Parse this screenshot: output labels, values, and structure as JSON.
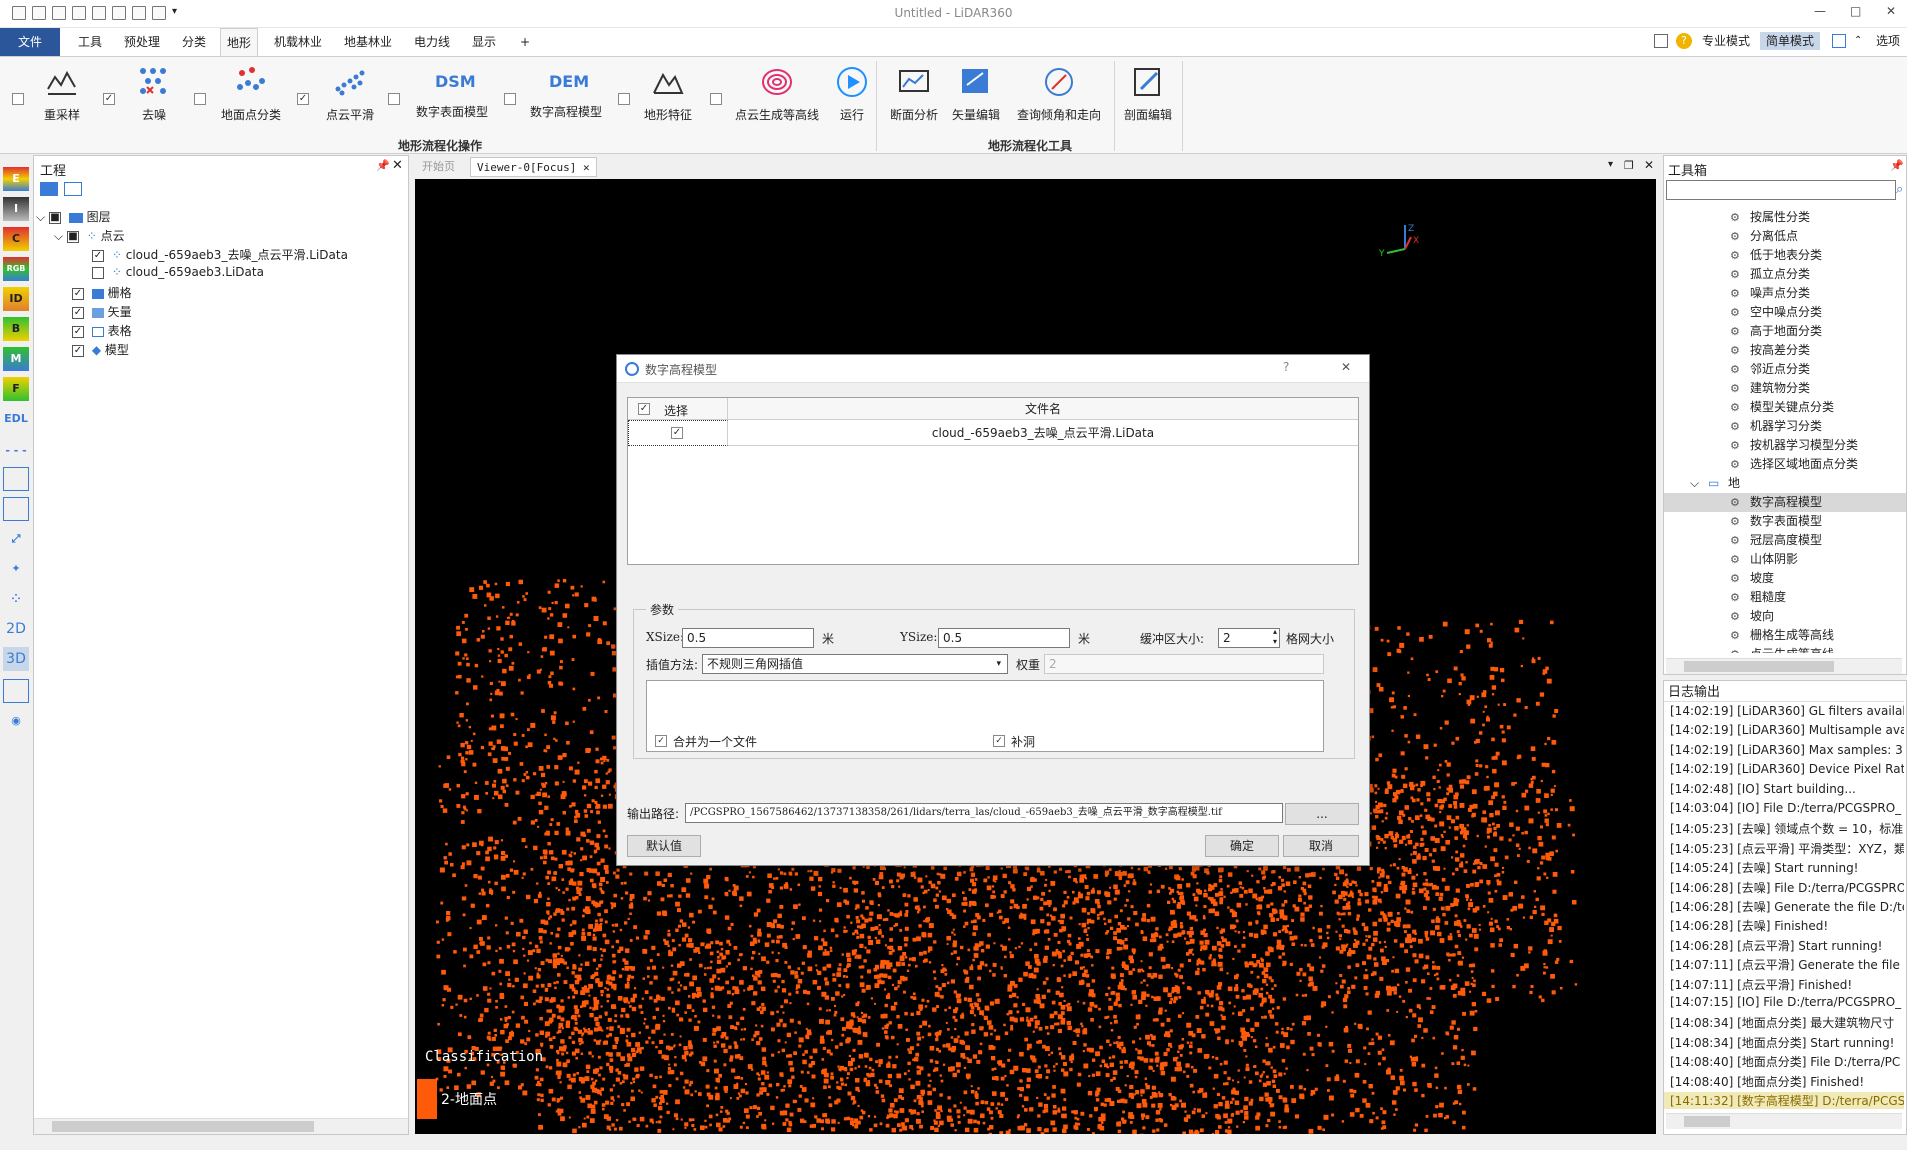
{
  "window": {
    "title": "Untitled - LiDAR360",
    "min": "—",
    "max": "□",
    "close": "✕"
  },
  "menu": {
    "tabs": [
      "文件",
      "工具",
      "预处理",
      "分类",
      "地形",
      "机载林业",
      "地基林业",
      "电力线",
      "显示",
      "+"
    ],
    "active_tab": "地形",
    "right": {
      "pro_mode": "专业模式",
      "simple_mode": "简单模式",
      "options": "选项"
    }
  },
  "ribbon": {
    "buttons": [
      "重采样",
      "去噪",
      "地面点分类",
      "点云平滑",
      "数字表面模型",
      "数字高程模型",
      "地形特征",
      "点云生成等高线",
      "运行",
      "断面分析",
      "矢量编辑",
      "查询倾角和走向",
      "剖面编辑"
    ],
    "dsm_text": "DSM",
    "dem_text": "DEM",
    "groups": [
      "地形流程化操作",
      "地形流程化工具"
    ]
  },
  "left_toolbar": [
    "E",
    "I",
    "C",
    "RGB",
    "ID",
    "B",
    "M",
    "F",
    "EDL",
    "2D",
    "3D"
  ],
  "project": {
    "title": "工程",
    "tree": {
      "layers": "图层",
      "pointcloud": "点云",
      "files": [
        "cloud_-659aeb3_去噪_点云平滑.LiData",
        "cloud_-659aeb3.LiData"
      ],
      "raster": "栅格",
      "vector": "矢量",
      "table": "表格",
      "model": "模型"
    }
  },
  "viewer": {
    "tabs": [
      "开始页",
      "Viewer-0[Focus]"
    ],
    "legend_title": "Classification",
    "legend_item": "2-地面点",
    "legend_color": "#ff5a0a",
    "axis_labels": {
      "x": "X",
      "y": "Y",
      "z": "Z"
    }
  },
  "toolbox": {
    "title": "工具箱",
    "search_placeholder": "",
    "items": [
      "按属性分类",
      "分离低点",
      "低于地表分类",
      "孤立点分类",
      "噪声点分类",
      "空中噪点分类",
      "高于地面分类",
      "按高差分类",
      "邻近点分类",
      "建筑物分类",
      "模型关键点分类",
      "机器学习分类",
      "按机器学习模型分类",
      "选择区域地面点分类"
    ],
    "category": "地形",
    "terrain_items": [
      "数字高程模型",
      "数字表面模型",
      "冠层高度模型",
      "山体阴影",
      "坡度",
      "粗糙度",
      "坡向",
      "栅格生成等高线",
      "点云生成等高线"
    ],
    "selected": "数字高程模型"
  },
  "log": {
    "title": "日志输出",
    "lines": [
      "[14:02:19] [LiDAR360]   GL filters availab",
      "[14:02:19] [LiDAR360]   Multisample ava",
      "[14:02:19] [LiDAR360]   Max samples: 3",
      "[14:02:19] [LiDAR360]   Device Pixel Rati",
      "[14:02:48] [IO]    Start building...",
      "[14:03:04] [IO]    File D:/terra/PCGSPRO_",
      "[14:05:23] [去噪]    领域点个数 = 10，标准",
      "[14:05:23] [点云平滑]   平滑类型：XYZ，類",
      "[14:05:24] [去噪]    Start running!",
      "[14:06:28] [去噪]    File D:/terra/PCGSPRO",
      "[14:06:28] [去噪]    Generate the file D:/te",
      "[14:06:28] [去噪]    Finished!",
      "[14:06:28] [点云平滑]   Start running!",
      "[14:07:11] [点云平滑]   Generate the file",
      "[14:07:11] [点云平滑]   Finished!",
      "[14:07:15] [IO]    File D:/terra/PCGSPRO_",
      "[14:08:34] [地面点分类]   最大建筑物尺寸",
      "[14:08:34] [地面点分类]   Start running!",
      "[14:08:40] [地面点分类]   File D:/terra/PC",
      "[14:08:40] [地面点分类]   Finished!",
      "[14:11:32] [数字高程模型]   D:/terra/PCGS"
    ]
  },
  "dialog": {
    "title": "数字高程模型",
    "help": "?",
    "close": "✕",
    "table": {
      "col_select": "选择",
      "col_filename": "文件名",
      "rows": [
        {
          "checked": true,
          "filename": "cloud_-659aeb3_去噪_点云平滑.LiData"
        }
      ]
    },
    "params_title": "参数",
    "xsize_label": "XSize:",
    "xsize": "0.5",
    "xsize_unit": "米",
    "ysize_label": "YSize:",
    "ysize": "0.5",
    "ysize_unit": "米",
    "buffer_label": "缓冲区大小:",
    "buffer": "2",
    "buffer_unit": "格网大小",
    "interp_label": "插值方法:",
    "interp": "不规则三角网插值",
    "weight_label": "权重",
    "weight": "2",
    "merge_label": "合并为一个文件",
    "fill_label": "补洞",
    "output_label": "输出路径:",
    "output_path": "/PCGSPRO_1567586462/13737138358/261/lidars/terra_las/cloud_-659aeb3_去噪_点云平滑_数字高程模型.tif",
    "browse": "...",
    "default_btn": "默认值",
    "ok_btn": "确定",
    "cancel_btn": "取消"
  }
}
